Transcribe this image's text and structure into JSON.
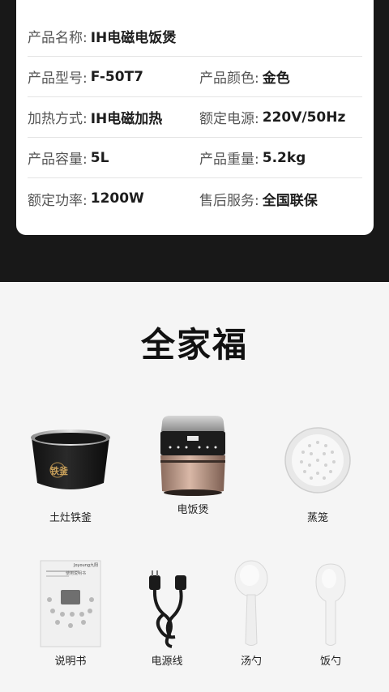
{
  "specs": [
    {
      "label": "产品名称:",
      "value": "IH电磁电饭煲"
    },
    {
      "label": "产品型号:",
      "value": "F-50T7",
      "label2": "产品颜色:",
      "value2": "金色"
    },
    {
      "label": "加热方式:",
      "value": "IH电磁加热",
      "label2": "额定电源:",
      "value2": "220V/50Hz"
    },
    {
      "label": "产品容量:",
      "value": "5L",
      "label2": "产品重量:",
      "value2": "5.2kg"
    },
    {
      "label": "额定功率:",
      "value": "1200W",
      "label2": "售后服务:",
      "value2": "全国联保"
    }
  ],
  "family": {
    "title": "全家福",
    "items": [
      {
        "label": "土灶铁釜",
        "icon": "inner-pot-icon",
        "pot_text": "铁釜"
      },
      {
        "label": "电饭煲",
        "icon": "rice-cooker-icon"
      },
      {
        "label": "蒸笼",
        "icon": "steamer-icon"
      },
      {
        "label": "说明书",
        "icon": "manual-icon",
        "brand": "Joyoung九阳",
        "doc_title": "使用说明书"
      },
      {
        "label": "电源线",
        "icon": "power-cord-icon"
      },
      {
        "label": "汤勺",
        "icon": "soup-ladle-icon"
      },
      {
        "label": "饭勺",
        "icon": "rice-paddle-icon"
      }
    ]
  },
  "colors": {
    "top_band": "#181818",
    "card": "#ffffff",
    "page": "#f5f5f5",
    "cooker_gold": "#b8907a"
  }
}
